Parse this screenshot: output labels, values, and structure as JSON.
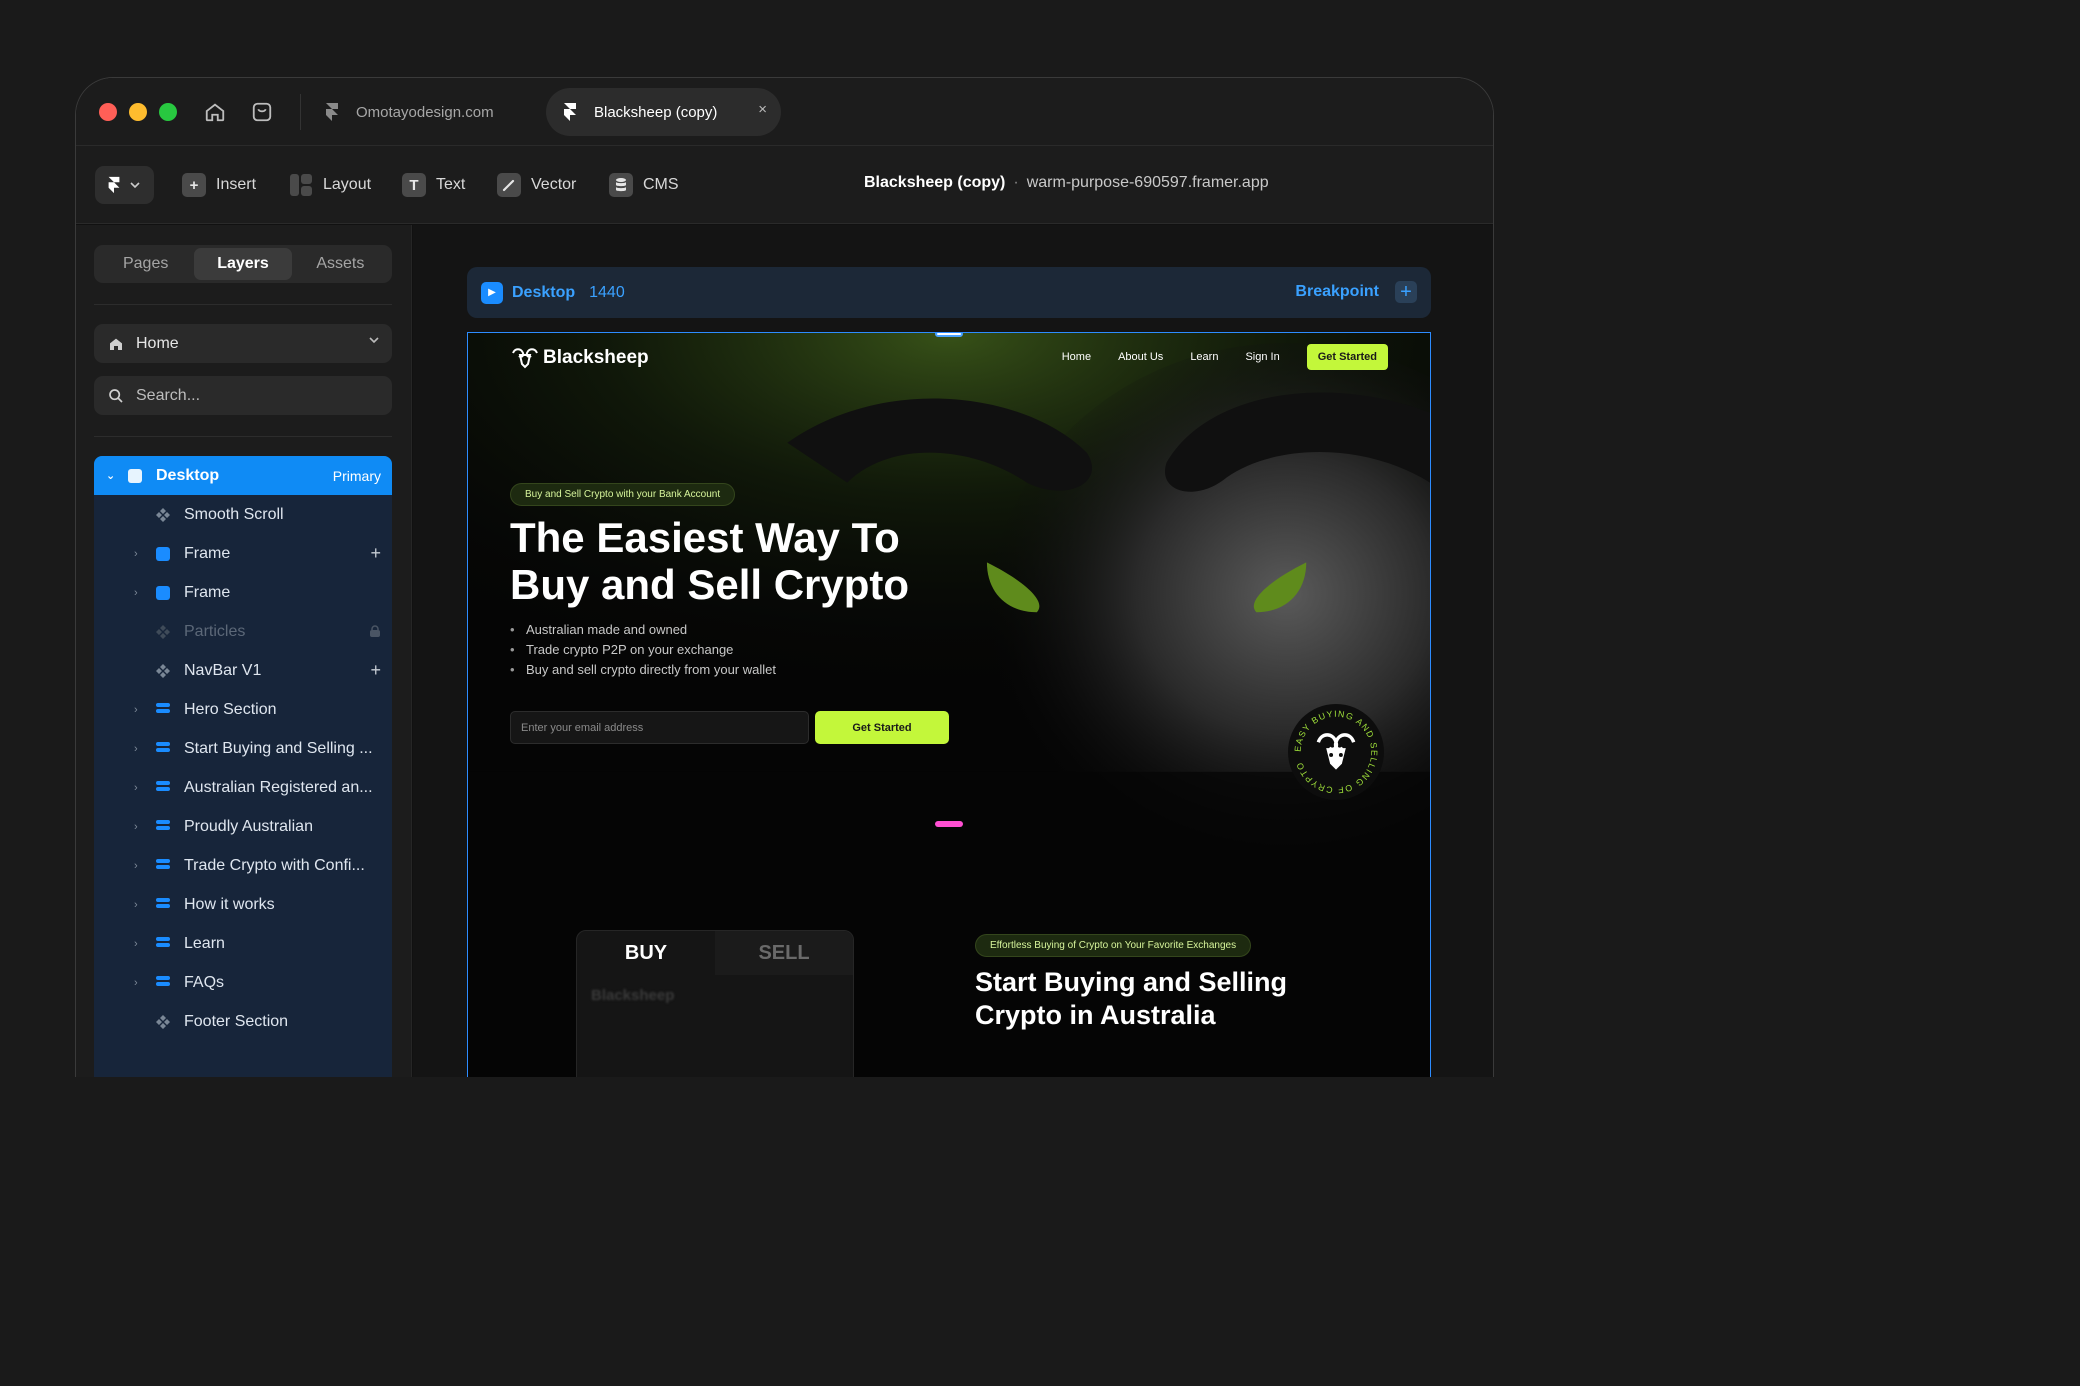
{
  "titlebar": {
    "tabs": [
      {
        "label": "Omotayodesign.com"
      },
      {
        "label": "Blacksheep (copy)",
        "close": "×"
      }
    ]
  },
  "toolbar": {
    "tools": [
      "Insert",
      "Layout",
      "Text",
      "Vector",
      "CMS"
    ],
    "project_name": "Blacksheep (copy)",
    "separator": "·",
    "url": "warm-purpose-690597.framer.app"
  },
  "leftpanel": {
    "segments": [
      "Pages",
      "Layers",
      "Assets"
    ],
    "page_select": "Home",
    "search_placeholder": "Search...",
    "layers": [
      {
        "name": "Desktop",
        "badge": "Primary"
      },
      {
        "name": "Smooth Scroll"
      },
      {
        "name": "Frame"
      },
      {
        "name": "Frame"
      },
      {
        "name": "Particles"
      },
      {
        "name": "NavBar V1"
      },
      {
        "name": "Hero  Section"
      },
      {
        "name": "Start Buying and Selling ..."
      },
      {
        "name": "Australian Registered an..."
      },
      {
        "name": "Proudly Australian"
      },
      {
        "name": "Trade Crypto with Confi..."
      },
      {
        "name": "How it works"
      },
      {
        "name": "Learn"
      },
      {
        "name": "FAQs"
      },
      {
        "name": "Footer Section"
      }
    ]
  },
  "canvas": {
    "breakpoint_name": "Desktop",
    "breakpoint_width": "1440",
    "breakpoint_label": "Breakpoint",
    "site": {
      "logo": "Blacksheep",
      "nav": [
        "Home",
        "About Us",
        "Learn",
        "Sign In"
      ],
      "nav_cta": "Get Started",
      "hero_pill": "Buy and Sell Crypto with your Bank Account",
      "hero_title_line1": "The Easiest Way To",
      "hero_title_line2": "Buy and Sell Crypto",
      "bullets": [
        "Australian made and owned",
        "Trade crypto P2P on your exchange",
        "Buy and sell crypto directly from your wallet"
      ],
      "email_placeholder": "Enter your email address",
      "cta": "Get Started",
      "badge_text": "EASY BUYING AND SELLING OF CRYPTO",
      "trade_buy": "BUY",
      "trade_sell": "SELL",
      "trade_brand": "Blacksheep",
      "section_pill": "Effortless Buying of Crypto on Your Favorite Exchanges",
      "section_title_line1": "Start Buying and Selling",
      "section_title_line2": "Crypto in Australia"
    }
  },
  "colors": {
    "accent_blue": "#0f8bf5",
    "lime": "#c3f73a",
    "close_red": "#ff5f57",
    "min_yellow": "#febc2e",
    "max_green": "#28c840"
  }
}
